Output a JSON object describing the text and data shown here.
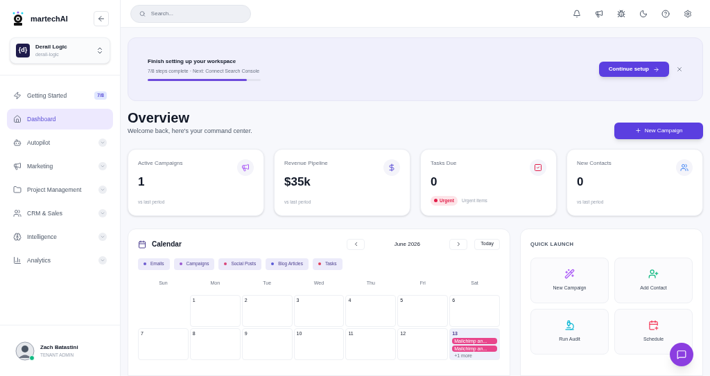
{
  "brand": {
    "name": "martechAI"
  },
  "workspace": {
    "name": "Derail Logic",
    "slug": "derail-logic",
    "logo": "{d}"
  },
  "nav": [
    {
      "label": "Getting Started",
      "badge": "7/8",
      "selected": false,
      "expandable": false
    },
    {
      "label": "Dashboard",
      "selected": true,
      "expandable": false
    },
    {
      "label": "Autopilot",
      "selected": false,
      "expandable": true
    },
    {
      "label": "Marketing",
      "selected": false,
      "expandable": true
    },
    {
      "label": "Project Management",
      "selected": false,
      "expandable": true
    },
    {
      "label": "CRM & Sales",
      "selected": false,
      "expandable": true
    },
    {
      "label": "Intelligence",
      "selected": false,
      "expandable": true
    },
    {
      "label": "Analytics",
      "selected": false,
      "expandable": true
    }
  ],
  "user": {
    "name": "Zach Batastini",
    "role": "TENANT ADMIN",
    "online": true
  },
  "search": {
    "placeholder": "Search..."
  },
  "setup": {
    "title": "Finish setting up your workspace",
    "subtitle": "7/8 steps complete · Next: Connect Search Console",
    "level": 0.875,
    "button": "Continue setup"
  },
  "header": {
    "title": "Overview",
    "subtitle": "Welcome back, here's your command center.",
    "button": "New Campaign"
  },
  "stats": [
    {
      "label": "Active Campaigns",
      "value": "1",
      "note": "vs last period"
    },
    {
      "label": "Revenue Pipeline",
      "value": "$35k",
      "note": "vs last period"
    },
    {
      "label": "Tasks Due",
      "value": "0",
      "tag": "Urgent",
      "note": "Urgent items"
    },
    {
      "label": "New Contacts",
      "value": "0",
      "note": "vs last period"
    }
  ],
  "calendar": {
    "title": "Calendar",
    "month": "June 2026",
    "today_button": "Today",
    "legend": [
      {
        "label": "Emails",
        "color": "#6d5bd0"
      },
      {
        "label": "Campaigns",
        "color": "#9b59d0"
      },
      {
        "label": "Social Posts",
        "color": "#d9467a"
      },
      {
        "label": "Blog Articles",
        "color": "#5b5bd6"
      },
      {
        "label": "Tasks",
        "color": "#e0405a"
      }
    ],
    "weekdays": [
      "Sun",
      "Mon",
      "Tue",
      "Wed",
      "Thu",
      "Fri",
      "Sat"
    ],
    "weeks": [
      [
        {
          "kind": "blank"
        },
        {
          "kind": "day",
          "label": "1",
          "today": false
        },
        {
          "kind": "day",
          "label": "2",
          "today": false
        },
        {
          "kind": "day",
          "label": "3",
          "today": false
        },
        {
          "kind": "day",
          "label": "4",
          "today": false
        },
        {
          "kind": "day",
          "label": "5",
          "today": false
        },
        {
          "kind": "day",
          "label": "6",
          "today": false
        }
      ],
      [
        {
          "kind": "day",
          "label": "7",
          "today": false
        },
        {
          "kind": "day",
          "label": "8",
          "today": false
        },
        {
          "kind": "day",
          "label": "9",
          "today": false
        },
        {
          "kind": "day",
          "label": "10",
          "today": false
        },
        {
          "kind": "day",
          "label": "11",
          "today": false
        },
        {
          "kind": "day",
          "label": "12",
          "today": false
        },
        {
          "kind": "day",
          "label": "13",
          "today": true,
          "events": [
            "Mailchimp an...",
            "Mailchimp an..."
          ],
          "more": "+1 more"
        }
      ]
    ]
  },
  "quick_launch": {
    "title": "QUICK LAUNCH",
    "items": [
      {
        "label": "New Campaign"
      },
      {
        "label": "Add Contact"
      },
      {
        "label": "Run Audit"
      },
      {
        "label": "Schedule"
      }
    ]
  }
}
